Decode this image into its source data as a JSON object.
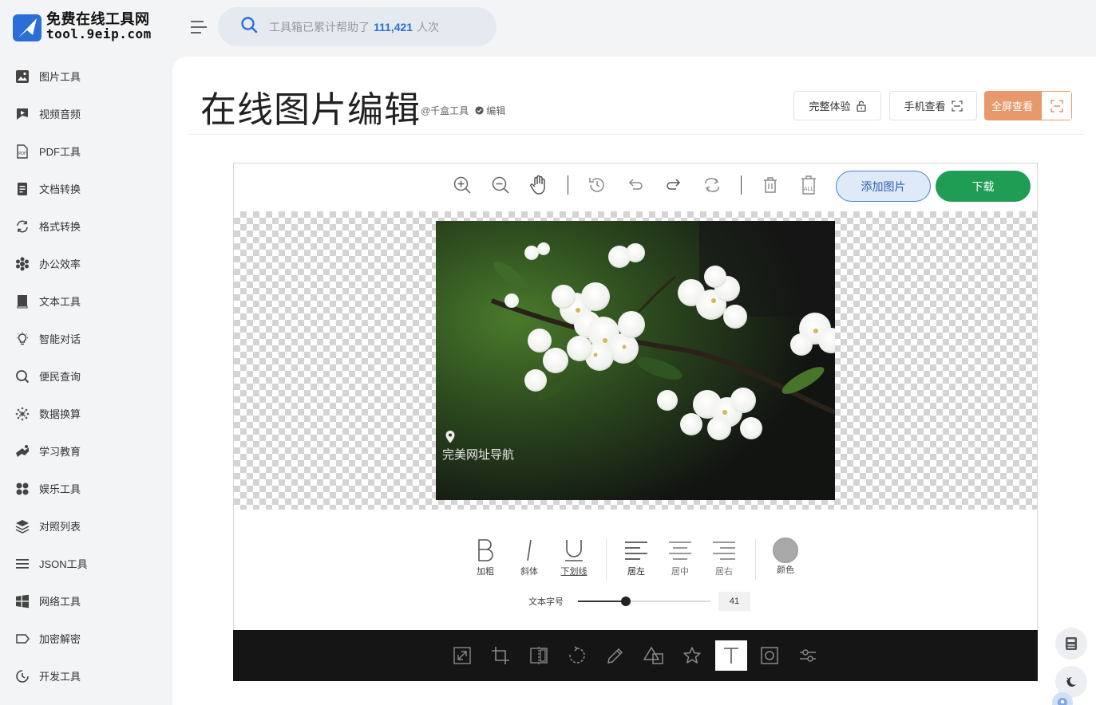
{
  "brand": {
    "title": "免费在线工具网",
    "url": "tool.9eip.com",
    "color": "#2b6fd6"
  },
  "sidebar": {
    "items": [
      {
        "label": "图片工具",
        "icon": "image-icon"
      },
      {
        "label": "视频音频",
        "icon": "video-icon"
      },
      {
        "label": "PDF工具",
        "icon": "pdf-icon"
      },
      {
        "label": "文档转换",
        "icon": "document-icon"
      },
      {
        "label": "格式转换",
        "icon": "convert-icon"
      },
      {
        "label": "办公效率",
        "icon": "office-icon"
      },
      {
        "label": "文本工具",
        "icon": "text-book-icon"
      },
      {
        "label": "智能对话",
        "icon": "bulb-icon"
      },
      {
        "label": "便民查询",
        "icon": "search-icon"
      },
      {
        "label": "数据换算",
        "icon": "data-icon"
      },
      {
        "label": "学习教育",
        "icon": "education-icon"
      },
      {
        "label": "娱乐工具",
        "icon": "entertainment-icon"
      },
      {
        "label": "对照列表",
        "icon": "layers-icon"
      },
      {
        "label": "JSON工具",
        "icon": "list-icon"
      },
      {
        "label": "网络工具",
        "icon": "windows-icon"
      },
      {
        "label": "加密解密",
        "icon": "lock-tag-icon"
      },
      {
        "label": "开发工具",
        "icon": "code-icon"
      }
    ]
  },
  "search": {
    "prefix": "工具箱已累计帮助了",
    "count": "111,421",
    "suffix": "人次"
  },
  "page": {
    "title": "在线图片编辑",
    "author": "@千盒工具",
    "edit_label": "编辑"
  },
  "header_buttons": {
    "full_experience": "完整体验",
    "mobile_view": "手机查看",
    "fullscreen": "全屏查看",
    "fullscreen_color": "#e8996b"
  },
  "editor": {
    "toolbar_icons": [
      "zoom-in-icon",
      "zoom-out-icon",
      "hand-icon",
      "history-icon",
      "undo-icon",
      "redo-icon",
      "reset-icon",
      "delete-icon",
      "delete-all-icon"
    ],
    "add_image": "添加图片",
    "download": "下载",
    "download_color": "#1f9d55",
    "watermark_text": "完美网址导航",
    "text_tools": {
      "bold": "加粗",
      "italic": "斜体",
      "underline": "下划线",
      "align_left": "居左",
      "align_center": "居中",
      "align_right": "居右",
      "color": "颜色",
      "color_value": "#a8a8a8",
      "font_size_label": "文本字号",
      "font_size_value": "41",
      "font_size_fraction": 0.36
    },
    "bottom_tools": [
      "resize-icon",
      "crop-icon",
      "flip-icon",
      "rotate-icon",
      "draw-icon",
      "shape-icon",
      "star-icon",
      "text-icon",
      "mask-icon",
      "filter-icon"
    ],
    "active_bottom_tool": "text-icon"
  }
}
